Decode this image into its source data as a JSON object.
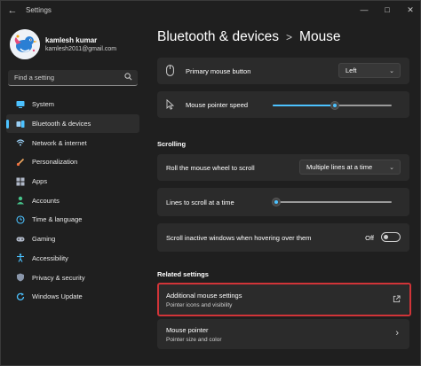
{
  "window": {
    "app_title": "Settings",
    "back_icon": "arrow-left-icon",
    "controls": [
      "minimize-icon",
      "maximize-icon",
      "close-icon"
    ]
  },
  "profile": {
    "name": "kamlesh kumar",
    "email": "kamlesh2011@gmail.com"
  },
  "search": {
    "placeholder": "Find a setting"
  },
  "sidebar": {
    "items": [
      {
        "label": "System",
        "icon": "monitor-icon"
      },
      {
        "label": "Bluetooth & devices",
        "icon": "bluetooth-icon",
        "active": true
      },
      {
        "label": "Network & internet",
        "icon": "wifi-icon"
      },
      {
        "label": "Personalization",
        "icon": "brush-icon"
      },
      {
        "label": "Apps",
        "icon": "apps-icon"
      },
      {
        "label": "Accounts",
        "icon": "person-icon"
      },
      {
        "label": "Time & language",
        "icon": "globe-clock-icon"
      },
      {
        "label": "Gaming",
        "icon": "gamepad-icon"
      },
      {
        "label": "Accessibility",
        "icon": "accessibility-icon"
      },
      {
        "label": "Privacy & security",
        "icon": "shield-icon"
      },
      {
        "label": "Windows Update",
        "icon": "update-icon"
      }
    ],
    "accent_color": "#4cc2ff"
  },
  "breadcrumb": {
    "parent": "Bluetooth & devices",
    "separator": ">",
    "current": "Mouse"
  },
  "settings": {
    "primary_button": {
      "label": "Primary mouse button",
      "value": "Left"
    },
    "pointer_speed": {
      "label": "Mouse pointer speed",
      "level": 0.52
    },
    "scrolling_title": "Scrolling",
    "roll_wheel": {
      "label": "Roll the mouse wheel to scroll",
      "value": "Multiple lines at a time"
    },
    "lines_to_scroll": {
      "label": "Lines to scroll at a time",
      "level": 0.03
    },
    "inactive_scroll": {
      "label": "Scroll inactive windows when hovering over them",
      "state": "Off"
    }
  },
  "related": {
    "title": "Related settings",
    "additional": {
      "label": "Additional mouse settings",
      "sublabel": "Pointer icons and visibility"
    },
    "pointer": {
      "label": "Mouse pointer",
      "sublabel": "Pointer size and color"
    }
  }
}
